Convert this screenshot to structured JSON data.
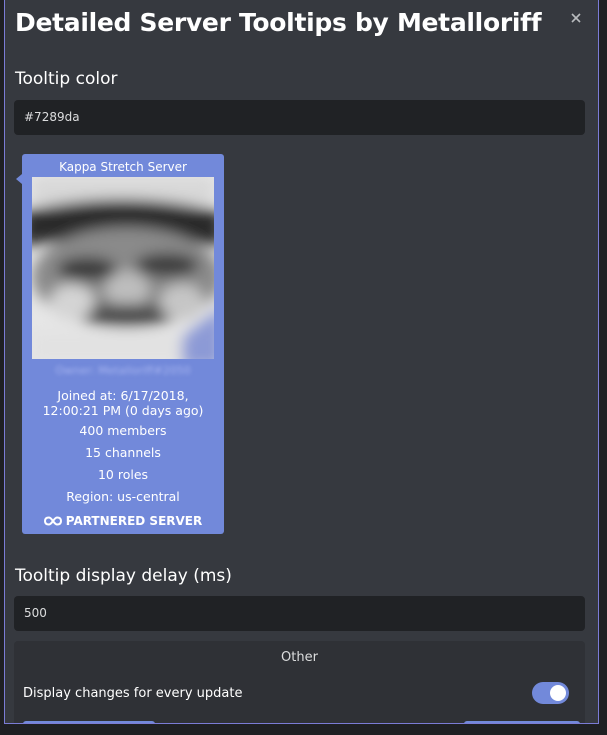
{
  "modal": {
    "title": "Detailed Server Tooltips by Metalloriff",
    "close_icon": "close-icon"
  },
  "settings": {
    "tooltip_color_label": "Tooltip color",
    "tooltip_color_value": "#7289da",
    "delay_label": "Tooltip display delay (ms)",
    "delay_value": "500"
  },
  "tooltip": {
    "server_name": "Kappa Stretch Server",
    "owner": "Owner: Metalloriff#2050",
    "joined": "Joined at: 6/17/2018, 12:00:21 PM (0 days ago)",
    "members": "400 members",
    "channels": "15 channels",
    "roles": "10 roles",
    "region": "Region: us-central",
    "partnered": "PARTNERED SERVER",
    "partner_icon": "infinity-icon",
    "background_color": "#7289da"
  },
  "other": {
    "title": "Other",
    "display_changes_label": "Display changes for every update",
    "display_changes_enabled": true,
    "left_button": "",
    "right_button": ""
  },
  "colors": {
    "accent": "#7289da",
    "background": "#36393f",
    "input_bg": "#202225",
    "panel_bg": "#2f3136"
  }
}
